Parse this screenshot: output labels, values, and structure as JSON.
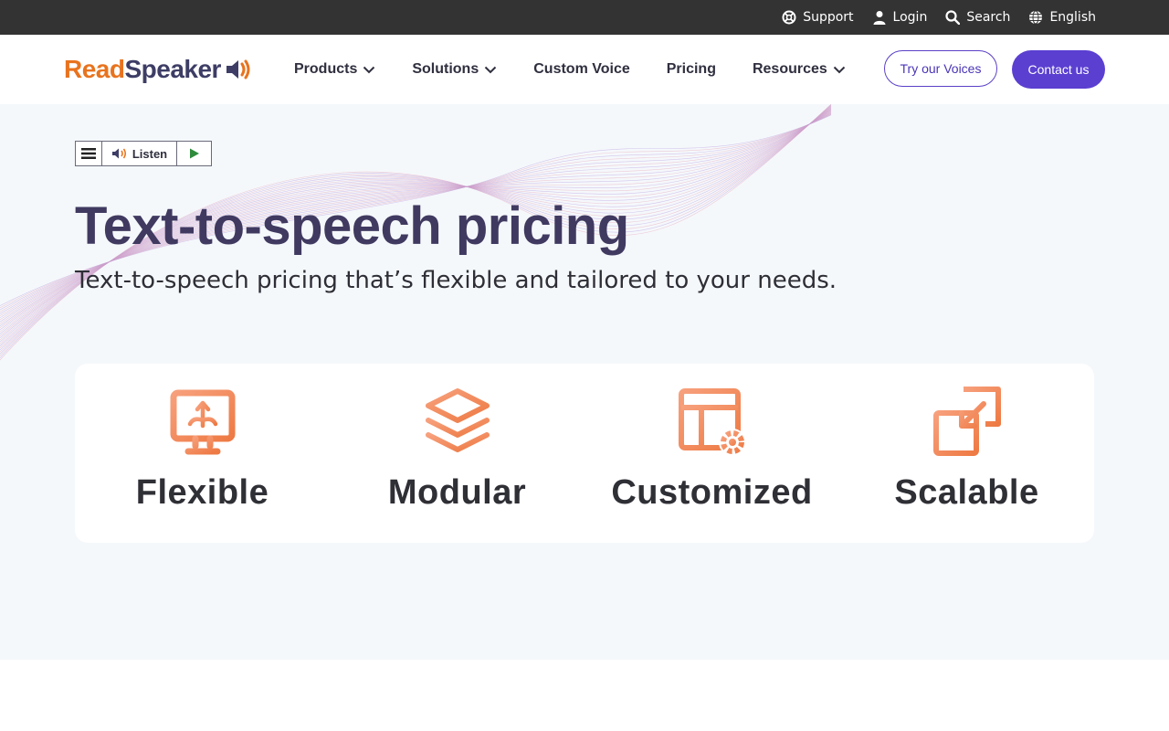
{
  "topbar": {
    "links": [
      {
        "label": "Support",
        "icon": "lifebuoy-icon"
      },
      {
        "label": "Login",
        "icon": "user-icon"
      },
      {
        "label": "Search",
        "icon": "search-icon"
      },
      {
        "label": "English",
        "icon": "globe-icon"
      }
    ]
  },
  "nav": {
    "logo_read": "Read",
    "logo_speaker": "Speaker",
    "items": [
      {
        "label": "Products",
        "dropdown": true
      },
      {
        "label": "Solutions",
        "dropdown": true
      },
      {
        "label": "Custom Voice",
        "dropdown": false
      },
      {
        "label": "Pricing",
        "dropdown": false
      },
      {
        "label": "Resources",
        "dropdown": true
      }
    ],
    "try_voices_label": "Try our Voices",
    "contact_label": "Contact us"
  },
  "listen": {
    "label": "Listen"
  },
  "hero": {
    "title": "Text-to-speech pricing",
    "subtitle": "Text-to-speech pricing that’s flexible and tailored to your needs."
  },
  "features": [
    {
      "label": "Flexible",
      "icon": "monitor-arrows-icon"
    },
    {
      "label": "Modular",
      "icon": "layers-icon"
    },
    {
      "label": "Customized",
      "icon": "layout-gear-icon"
    },
    {
      "label": "Scalable",
      "icon": "resize-arrow-icon"
    }
  ],
  "colors": {
    "topbar_bg": "#333333",
    "brand_orange": "#e8731e",
    "brand_navy": "#3d3d66",
    "accent_purple": "#5b3fd1",
    "hero_bg": "#f5f8fb",
    "icon_gradient_start": "#f7a07c",
    "icon_gradient_end": "#ee7a44"
  }
}
